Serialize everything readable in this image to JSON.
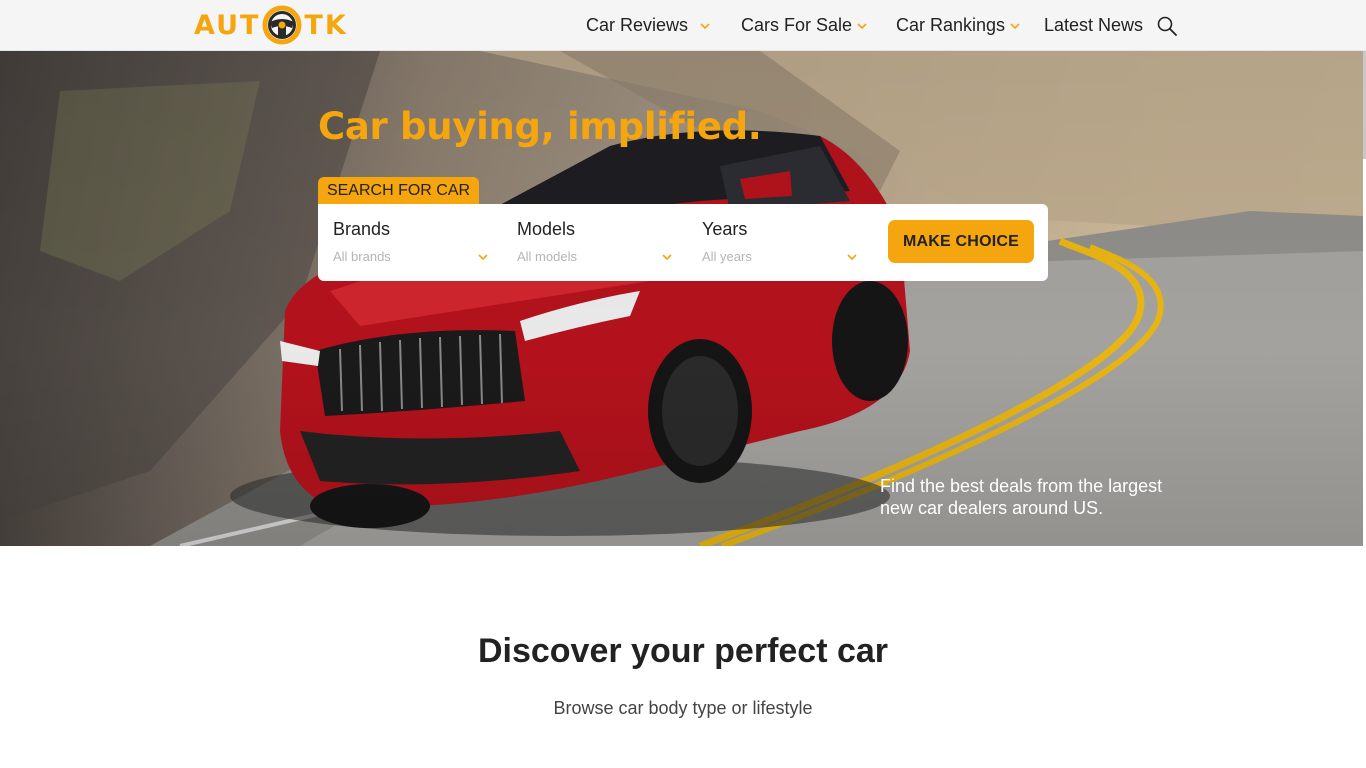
{
  "brand": {
    "logo_left": "AUT",
    "logo_right": "TK",
    "accent": "#f5a50d"
  },
  "nav": {
    "items": [
      {
        "label": "Car Reviews",
        "dropdown": true
      },
      {
        "label": "Cars For Sale",
        "dropdown": true
      },
      {
        "label": "Car Rankings",
        "dropdown": true
      },
      {
        "label": "Latest News",
        "dropdown": false
      }
    ],
    "search_icon": "search-icon"
  },
  "hero": {
    "headline": "Car buying, implified.",
    "search_tab": "SEARCH FOR CAR",
    "fields": [
      {
        "label": "Brands",
        "placeholder": "All brands"
      },
      {
        "label": "Models",
        "placeholder": "All models"
      },
      {
        "label": "Years",
        "placeholder": "All years"
      }
    ],
    "button": "MAKE CHOICE",
    "note": "Find the best deals from the largest new car dealers around US."
  },
  "discover": {
    "title": "Discover your perfect car",
    "subtitle": "Browse car body type or lifestyle"
  }
}
